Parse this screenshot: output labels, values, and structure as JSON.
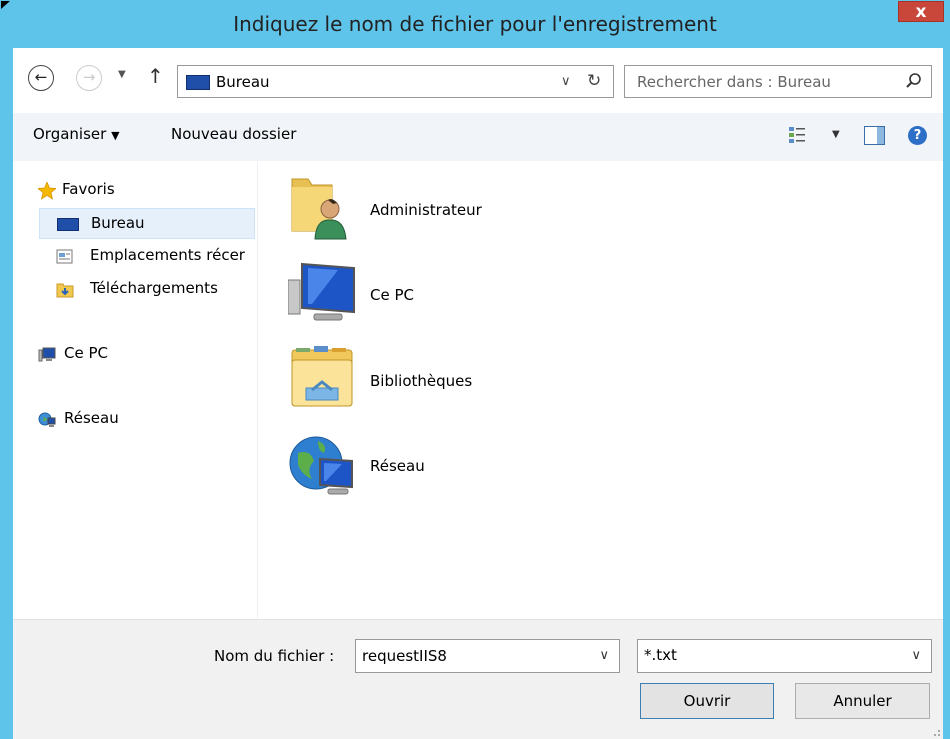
{
  "window": {
    "title": "Indiquez le nom de fichier pour l'enregistrement",
    "close_label": "x"
  },
  "navbar": {
    "address": "Bureau",
    "search_placeholder": "Rechercher dans : Bureau"
  },
  "toolbar": {
    "organize_label": "Organiser",
    "new_folder_label": "Nouveau dossier"
  },
  "sidebar": {
    "favorites_label": "Favoris",
    "items": [
      {
        "label": "Bureau",
        "icon": "desktop-icon",
        "selected": true
      },
      {
        "label": "Emplacements récer",
        "icon": "recent-places-icon",
        "selected": false
      },
      {
        "label": "Téléchargements",
        "icon": "downloads-folder-icon",
        "selected": false
      }
    ],
    "this_pc_label": "Ce PC",
    "network_label": "Réseau"
  },
  "content": {
    "items": [
      {
        "name": "Administrateur",
        "icon": "user-folder-icon"
      },
      {
        "name": "Ce PC",
        "icon": "computer-icon"
      },
      {
        "name": "Bibliothèques",
        "icon": "libraries-icon"
      },
      {
        "name": "Réseau",
        "icon": "network-globe-icon"
      }
    ]
  },
  "footer": {
    "filename_label": "Nom du fichier :",
    "filename_value": "requestIIS8",
    "filetype_value": "*.txt",
    "open_label": "Ouvrir",
    "cancel_label": "Annuler"
  },
  "colors": {
    "frame": "#5ec4ea",
    "close": "#c9463a",
    "selection": "#e5f0fb",
    "toolbar": "#f1f4f9"
  }
}
